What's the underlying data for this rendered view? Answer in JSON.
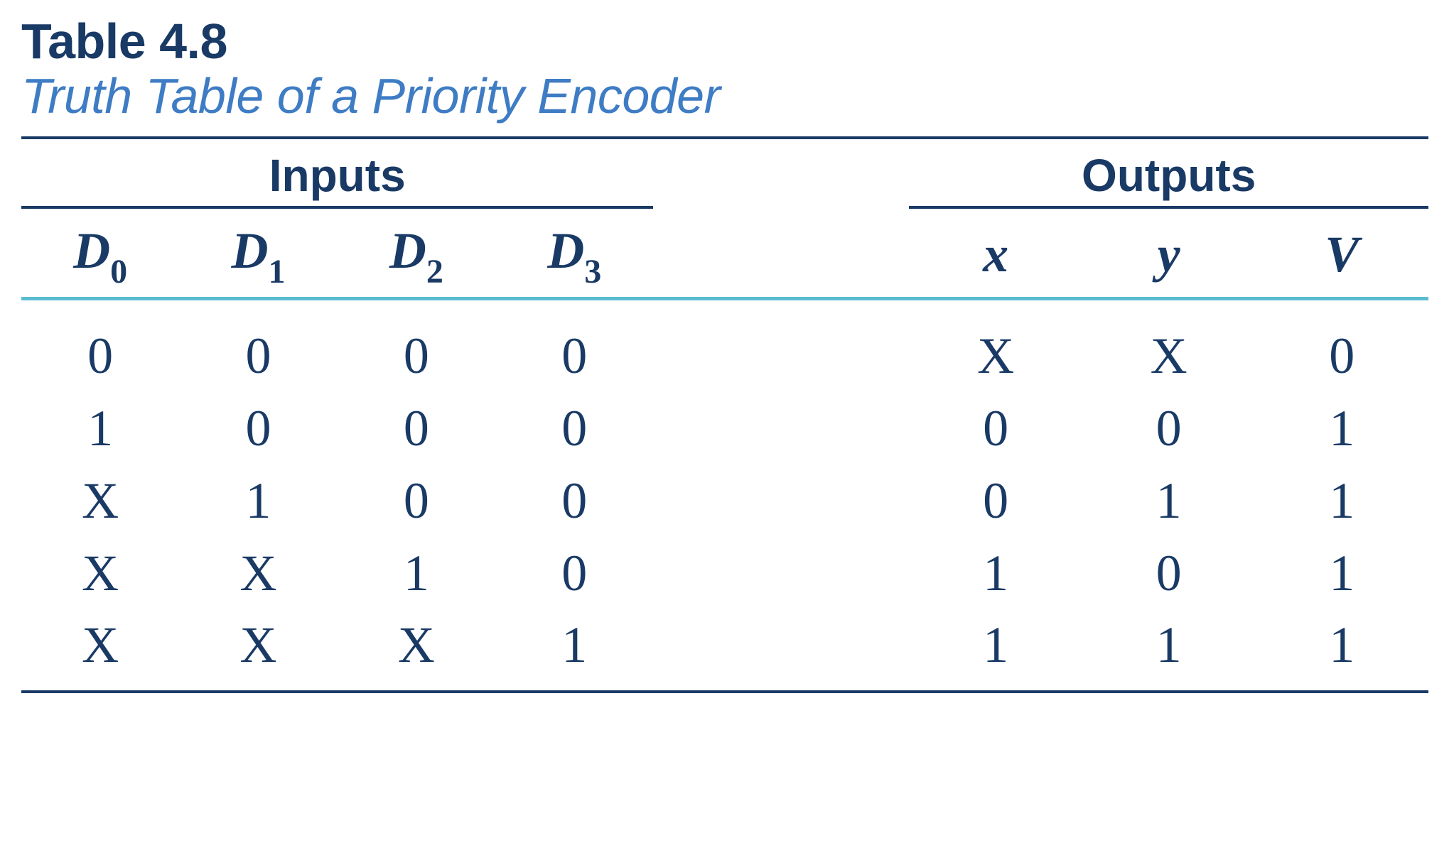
{
  "caption": {
    "number": "Table 4.8",
    "title": "Truth Table of a Priority Encoder"
  },
  "groups": {
    "inputs": "Inputs",
    "outputs": "Outputs"
  },
  "columns": {
    "d0": {
      "base": "D",
      "sub": "0"
    },
    "d1": {
      "base": "D",
      "sub": "1"
    },
    "d2": {
      "base": "D",
      "sub": "2"
    },
    "d3": {
      "base": "D",
      "sub": "3"
    },
    "x": {
      "base": "x",
      "sub": ""
    },
    "y": {
      "base": "y",
      "sub": ""
    },
    "v": {
      "base": "V",
      "sub": ""
    }
  },
  "rows": [
    {
      "d0": "0",
      "d1": "0",
      "d2": "0",
      "d3": "0",
      "x": "X",
      "y": "X",
      "v": "0"
    },
    {
      "d0": "1",
      "d1": "0",
      "d2": "0",
      "d3": "0",
      "x": "0",
      "y": "0",
      "v": "1"
    },
    {
      "d0": "X",
      "d1": "1",
      "d2": "0",
      "d3": "0",
      "x": "0",
      "y": "1",
      "v": "1"
    },
    {
      "d0": "X",
      "d1": "X",
      "d2": "1",
      "d3": "0",
      "x": "1",
      "y": "0",
      "v": "1"
    },
    {
      "d0": "X",
      "d1": "X",
      "d2": "X",
      "d3": "1",
      "x": "1",
      "y": "1",
      "v": "1"
    }
  ],
  "chart_data": {
    "type": "table",
    "title": "Truth Table of a Priority Encoder",
    "columns": [
      "D0",
      "D1",
      "D2",
      "D3",
      "x",
      "y",
      "V"
    ],
    "rows": [
      [
        "0",
        "0",
        "0",
        "0",
        "X",
        "X",
        "0"
      ],
      [
        "1",
        "0",
        "0",
        "0",
        "0",
        "0",
        "1"
      ],
      [
        "X",
        "1",
        "0",
        "0",
        "0",
        "1",
        "1"
      ],
      [
        "X",
        "X",
        "1",
        "0",
        "1",
        "0",
        "1"
      ],
      [
        "X",
        "X",
        "X",
        "1",
        "1",
        "1",
        "1"
      ]
    ]
  }
}
